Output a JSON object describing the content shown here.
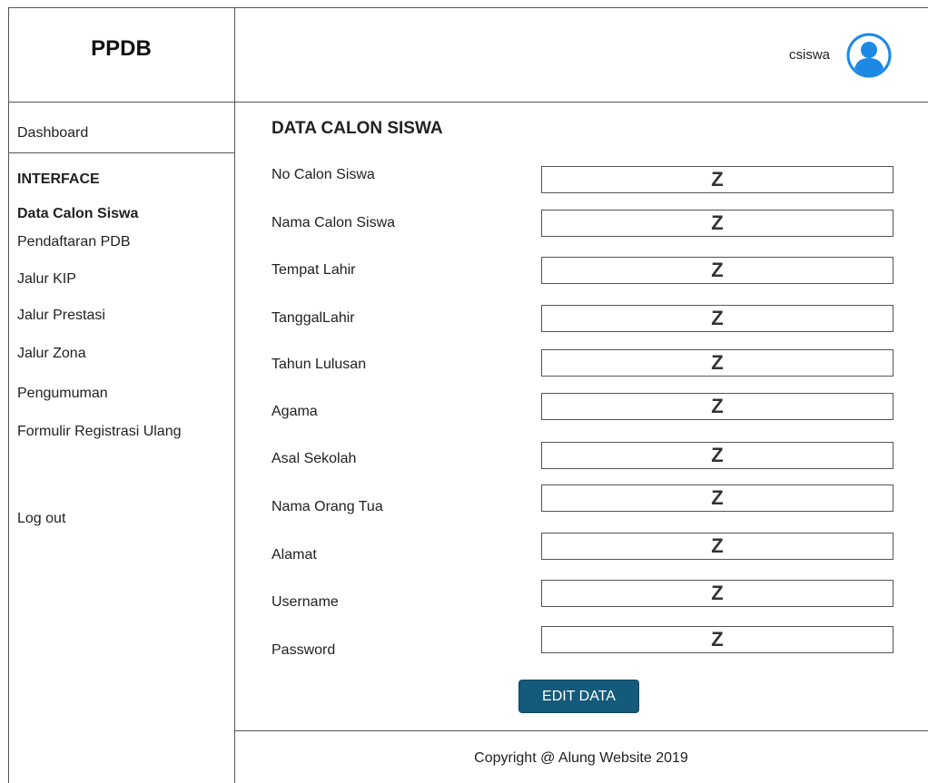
{
  "header": {
    "brand": "PPDB",
    "username": "csiswa",
    "avatar_icon": "user-avatar-icon",
    "accent_color": "#1e88e5"
  },
  "sidebar": {
    "dashboard": "Dashboard",
    "section_heading": "INTERFACE",
    "items": [
      "Data Calon Siswa",
      "Pendaftaran PDB",
      "Jalur KIP",
      "Jalur Prestasi",
      "Jalur Zona",
      "Pengumuman",
      "Formulir Registrasi Ulang"
    ],
    "logout": "Log out"
  },
  "main": {
    "title": "DATA CALON SISWA",
    "fields": [
      {
        "label": "No Calon Siswa",
        "value": "Z"
      },
      {
        "label": "Nama Calon Siswa",
        "value": "Z"
      },
      {
        "label": "Tempat Lahir",
        "value": "Z"
      },
      {
        "label": "TanggalLahir",
        "value": "Z"
      },
      {
        "label": "Tahun Lulusan",
        "value": "Z"
      },
      {
        "label": "Agama",
        "value": "Z"
      },
      {
        "label": "Asal Sekolah",
        "value": "Z"
      },
      {
        "label": "Nama Orang Tua",
        "value": "Z"
      },
      {
        "label": "Alamat",
        "value": "Z"
      },
      {
        "label": "Username",
        "value": "Z"
      },
      {
        "label": "Password",
        "value": "Z"
      }
    ],
    "edit_button": "EDIT DATA",
    "button_color": "#145a7a"
  },
  "footer": {
    "text": "Copyright @ Alung Website 2019"
  }
}
